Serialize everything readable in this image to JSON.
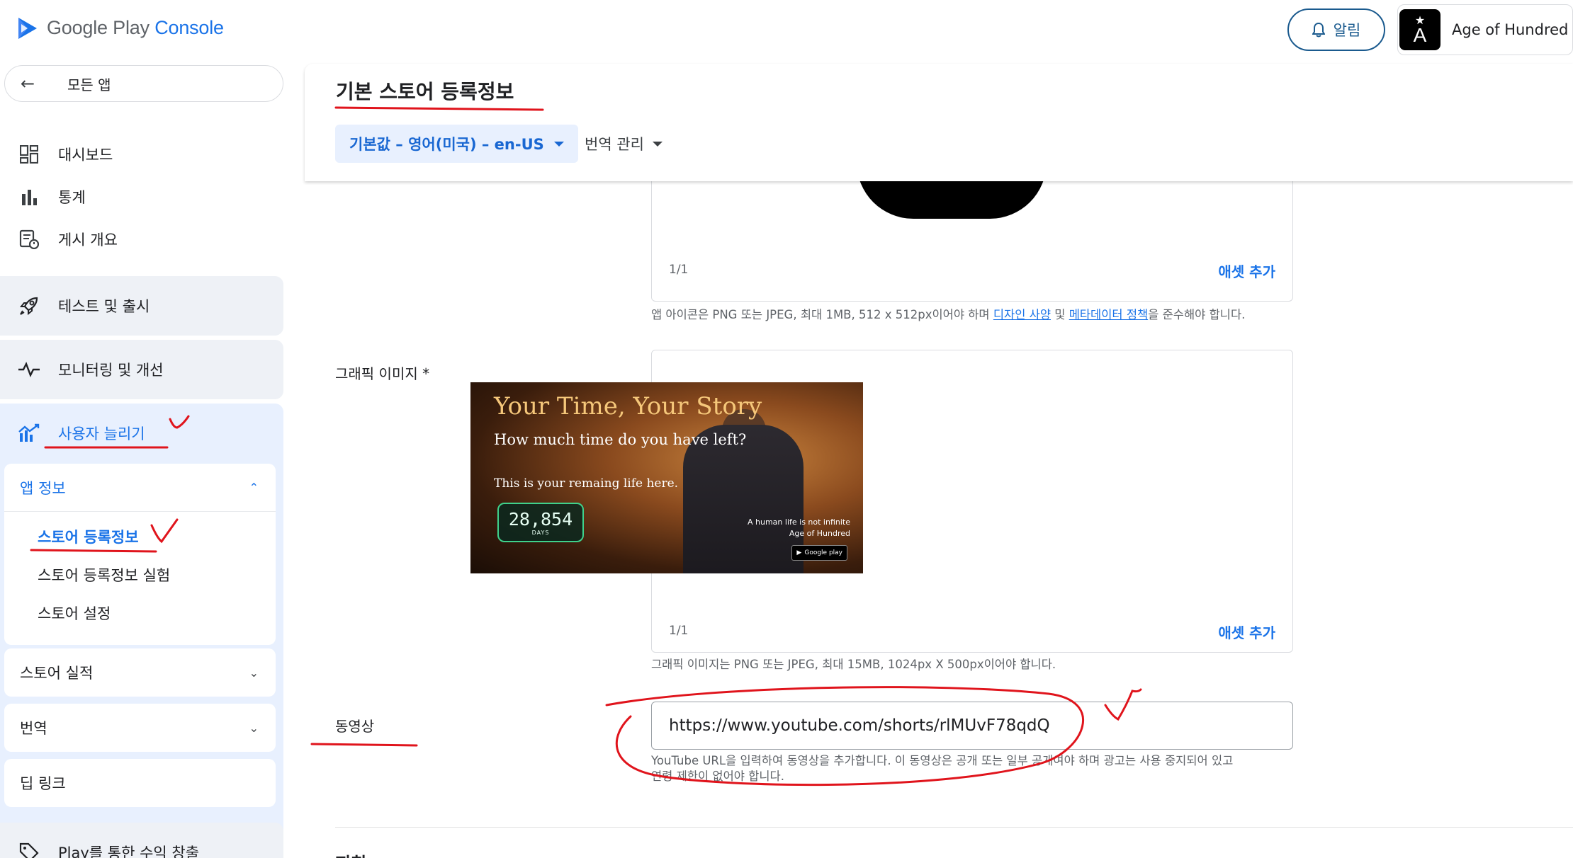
{
  "header": {
    "logo_text_primary": "Google Play ",
    "logo_text_accent": "Console",
    "notifications_label": "알림",
    "app_name": "Age of Hundred"
  },
  "sidebar": {
    "back_label": "모든 앱",
    "items": [
      {
        "label": "대시보드",
        "icon": "dashboard-icon"
      },
      {
        "label": "통계",
        "icon": "bar-chart-icon"
      },
      {
        "label": "게시 개요",
        "icon": "publishing-overview-icon"
      }
    ],
    "groups": {
      "test_release": "테스트 및 출시",
      "monitor": "모니터링 및 개선",
      "grow": "사용자 늘리기",
      "monetize": "Play를 통한 수익 창출"
    },
    "app_info": {
      "label": "앱 정보",
      "sub_items": [
        "스토어 등록정보",
        "스토어 등록정보 실험",
        "스토어 설정"
      ]
    },
    "store_performance": "스토어 실적",
    "translation": "번역",
    "deep_links": "딥 링크"
  },
  "main": {
    "title": "기본 스토어 등록정보",
    "language_chip": "기본값 – 영어(미국) – en-US",
    "translation_menu": "번역 관리"
  },
  "icon_section": {
    "counter": "1/1",
    "add_asset": "애셋 추가",
    "help_prefix": "앱 아이콘은 PNG 또는 JPEG, 최대 1MB, 512 x 512px이어야 하며 ",
    "help_link1": "디자인 사양",
    "help_mid": " 및 ",
    "help_link2": "메타데이터 정책",
    "help_suffix": "을 준수해야 합니다."
  },
  "graphic_section": {
    "label": "그래픽 이미지  *",
    "counter": "1/1",
    "add_asset": "애셋 추가",
    "help": "그래픽 이미지는 PNG 또는 JPEG, 최대 15MB, 1024px X 500px이어야 합니다.",
    "image": {
      "title": "Your Time, Your Story",
      "subtitle": "How much time do you have left?",
      "line": "This is your remaing life here.",
      "days_value": "28,854",
      "days_unit": "DAYS",
      "caption_line1": "A human life is not infinite",
      "caption_line2": "Age of Hundred",
      "badge": "Google play"
    }
  },
  "video_section": {
    "label": "동영상",
    "url_value": "https://www.youtube.com/shorts/rlMUvF78qdQ",
    "help_line1": "YouTube URL을 입력하여 동영상을 추가합니다. 이 동영상은 공개 또는 일부 공개여야 하며 광고는 사용 중지되어 있고",
    "help_line2": "연령 제한이 없어야 합니다."
  },
  "next_section_label": "지침",
  "colors": {
    "accent_blue": "#1a73e8",
    "annotation_red": "#e0141c",
    "selected_group_bg": "#e8f0fe"
  }
}
